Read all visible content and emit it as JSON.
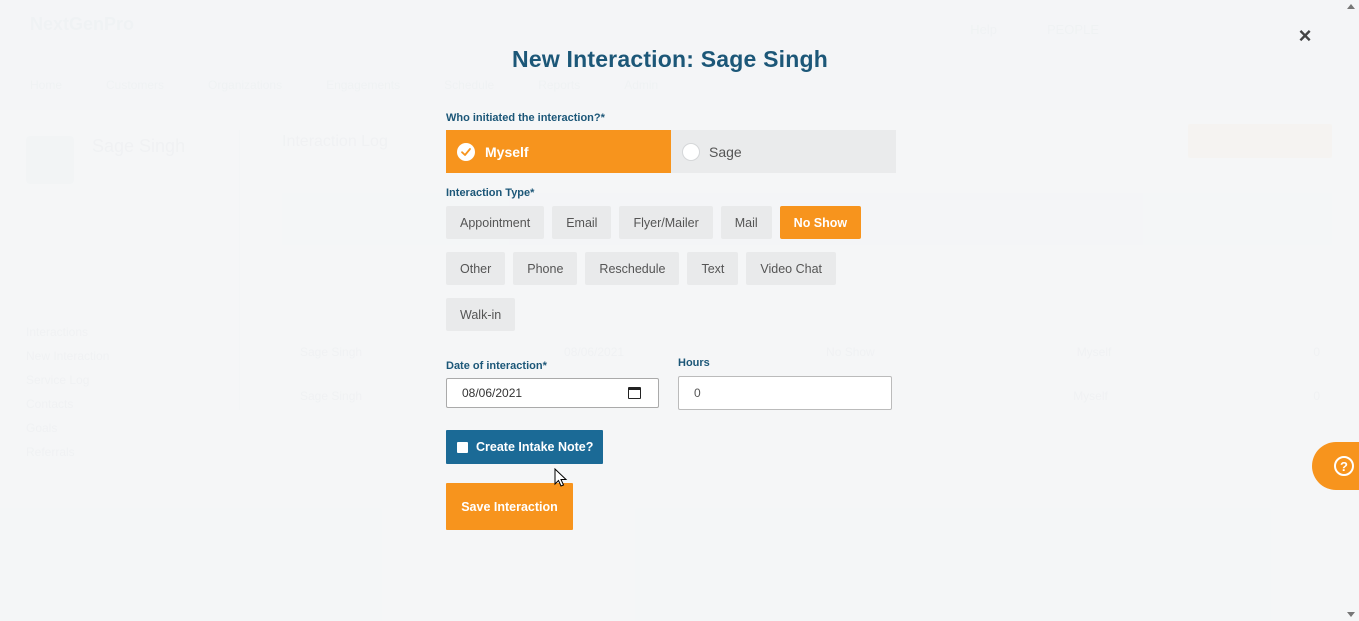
{
  "background": {
    "logo": "NextGenPro",
    "nav": [
      "Home",
      "Customers",
      "Organizations",
      "Engagements",
      "Schedule",
      "Reports",
      "Admin"
    ],
    "topright": [
      "Help",
      "PEOPLE"
    ],
    "profile_name": "Sage Singh",
    "side_items": [
      "Interactions",
      "New Interaction",
      "Service Log",
      "Contacts",
      "Goals",
      "Referrals"
    ],
    "content_title": "Interaction Log",
    "table_rows": [
      [
        "Sage Singh",
        "08/06/2021",
        "No Show",
        "Myself",
        "0"
      ],
      [
        "Sage Singh",
        "08/05/2021",
        "Phone",
        "Myself",
        "0"
      ]
    ]
  },
  "modal": {
    "title": "New Interaction: Sage Singh",
    "close_label": "×",
    "initiator": {
      "label": "Who initiated the interaction?*",
      "options": [
        {
          "label": "Myself",
          "selected": true
        },
        {
          "label": "Sage",
          "selected": false
        }
      ]
    },
    "interaction_type": {
      "label": "Interaction Type*",
      "rows": [
        [
          "Appointment",
          "Email",
          "Flyer/Mailer",
          "Mail",
          "No Show"
        ],
        [
          "Other",
          "Phone",
          "Reschedule",
          "Text",
          "Video Chat"
        ],
        [
          "Walk-in"
        ]
      ],
      "selected": "No Show"
    },
    "date": {
      "label": "Date of interaction*",
      "value": "08/06/2021"
    },
    "hours": {
      "label": "Hours",
      "value": "0"
    },
    "intake_note_label": "Create Intake Note?",
    "save_label": "Save Interaction"
  },
  "help_label": "?",
  "colors": {
    "accent": "#f7941d",
    "primary": "#1b6a96",
    "title": "#1c5778"
  }
}
